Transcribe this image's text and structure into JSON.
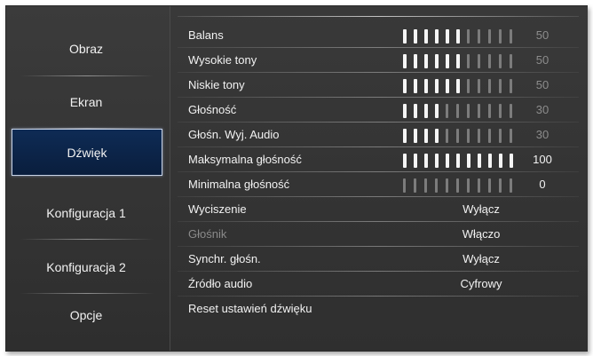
{
  "sidebar": {
    "items": [
      {
        "label": "Obraz"
      },
      {
        "label": "Ekran"
      },
      {
        "label": "Dźwięk"
      },
      {
        "label": "Konfiguracja 1"
      },
      {
        "label": "Konfiguracja 2"
      },
      {
        "label": "Opcje"
      }
    ],
    "selected_index": 2
  },
  "settings": {
    "balans": {
      "label": "Balans",
      "value": "50",
      "level": 6,
      "max": 11
    },
    "wysokie_tony": {
      "label": "Wysokie tony",
      "value": "50",
      "level": 6,
      "max": 11
    },
    "niskie_tony": {
      "label": "Niskie tony",
      "value": "50",
      "level": 6,
      "max": 11
    },
    "glosnosc": {
      "label": "Głośność",
      "value": "30",
      "level": 4,
      "max": 11
    },
    "glosn_wyj_audio": {
      "label": "Głośn. Wyj. Audio",
      "value": "30",
      "level": 4,
      "max": 11
    },
    "maks_glosnosc": {
      "label": "Maksymalna głośność",
      "value": "100",
      "level": 11,
      "max": 11
    },
    "min_glosnosc": {
      "label": "Minimalna głośność",
      "value": "0",
      "level": 0,
      "max": 11
    },
    "wyciszenie": {
      "label": "Wyciszenie",
      "value": "Wyłącz"
    },
    "glosnik": {
      "label": "Głośnik",
      "value": "Włączo"
    },
    "synchr_glosn": {
      "label": "Synchr. głośn.",
      "value": "Wyłącz"
    },
    "zrodlo_audio": {
      "label": "Źródło audio",
      "value": "Cyfrowy"
    },
    "reset": {
      "label": "Reset ustawień dźwięku"
    }
  },
  "colors": {
    "selected_bg": "#0e2b55",
    "bar_on": "#f5f5f5",
    "bar_off": "#7c7c7c",
    "text": "#f2f2f2",
    "dim_text": "#8c8c8c"
  }
}
